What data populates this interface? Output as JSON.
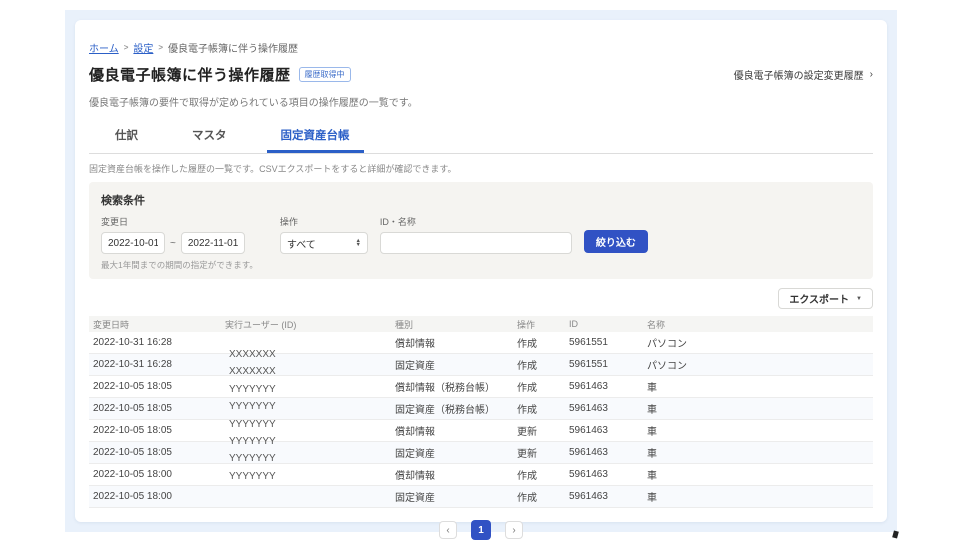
{
  "colors": {
    "accent_link": "#2b5fc7",
    "button_blue": "#3152c4",
    "page_background": "#e9f1fb",
    "panel_background": "#f5f4f1"
  },
  "breadcrumb": {
    "separator": ">",
    "items": [
      {
        "label": "ホーム",
        "link": true
      },
      {
        "label": "設定",
        "link": true
      },
      {
        "label": "優良電子帳簿に伴う操作履歴",
        "link": false
      }
    ]
  },
  "header": {
    "title": "優良電子帳簿に伴う操作履歴",
    "badge": "履歴取得中",
    "right_link": "優良電子帳簿の設定変更履歴",
    "right_link_chevron": "›",
    "description": "優良電子帳簿の要件で取得が定められている項目の操作履歴の一覧です。"
  },
  "tabs": [
    {
      "label": "仕訳",
      "active": false
    },
    {
      "label": "マスタ",
      "active": false
    },
    {
      "label": "固定資産台帳",
      "active": true
    }
  ],
  "tab_description": "固定資産台帳を操作した履歴の一覧です。CSVエクスポートをすると詳細が確認できます。",
  "search": {
    "title": "検索条件",
    "date_label": "変更日",
    "date_from": "2022-10-01",
    "date_separator": "~",
    "date_to": "2022-11-01",
    "operation_label": "操作",
    "operation_value": "すべて",
    "id_name_label": "ID・名称",
    "id_name_value": "",
    "helper": "最大1年間までの期間の指定ができます。",
    "submit_label": "絞り込む"
  },
  "toolbar": {
    "export_label": "エクスポート",
    "caret": "▼"
  },
  "table": {
    "headers": [
      "変更日時",
      "実行ユーザー (ID)",
      "種別",
      "操作",
      "ID",
      "名称"
    ],
    "rows": [
      {
        "datetime": "2022-10-31 16:28",
        "user": "XXXXXXX",
        "type": "償却情報",
        "operation": "作成",
        "id": "5961551",
        "name": "パソコン"
      },
      {
        "datetime": "2022-10-31 16:28",
        "user": "XXXXXXX",
        "type": "固定資産",
        "operation": "作成",
        "id": "5961551",
        "name": "パソコン"
      },
      {
        "datetime": "2022-10-05 18:05",
        "user": "YYYYYYY",
        "type": "償却情報（税務台帳）",
        "operation": "作成",
        "id": "5961463",
        "name": "車"
      },
      {
        "datetime": "2022-10-05 18:05",
        "user": "YYYYYYY",
        "type": "固定資産（税務台帳）",
        "operation": "作成",
        "id": "5961463",
        "name": "車"
      },
      {
        "datetime": "2022-10-05 18:05",
        "user": "YYYYYYY",
        "type": "償却情報",
        "operation": "更新",
        "id": "5961463",
        "name": "車"
      },
      {
        "datetime": "2022-10-05 18:05",
        "user": "YYYYYYY",
        "type": "固定資産",
        "operation": "更新",
        "id": "5961463",
        "name": "車"
      },
      {
        "datetime": "2022-10-05 18:00",
        "user": "YYYYYYY",
        "type": "償却情報",
        "operation": "作成",
        "id": "5961463",
        "name": "車"
      },
      {
        "datetime": "2022-10-05 18:00",
        "user": "YYYYYYY",
        "type": "固定資産",
        "operation": "作成",
        "id": "5961463",
        "name": "車"
      }
    ]
  },
  "pagination": {
    "prev": "‹",
    "current": "1",
    "next": "›"
  }
}
